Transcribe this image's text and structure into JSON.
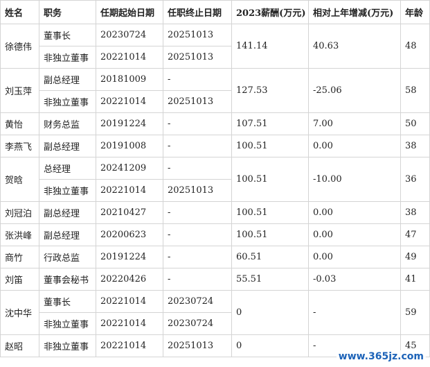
{
  "headers": [
    "姓名",
    "职务",
    "任期起始日期",
    "任职终止日期",
    "2023薪酬(万元)",
    "相对上年增减(万元)",
    "年龄"
  ],
  "people": [
    {
      "name": "徐德伟",
      "roles": [
        {
          "title": "董事长",
          "start": "20230724",
          "end": "20251013"
        },
        {
          "title": "非独立董事",
          "start": "20221014",
          "end": "20251013"
        }
      ],
      "salary": "141.14",
      "change": "40.63",
      "age": "48"
    },
    {
      "name": "刘玉萍",
      "roles": [
        {
          "title": "副总经理",
          "start": "20181009",
          "end": "-"
        },
        {
          "title": "非独立董事",
          "start": "20221014",
          "end": "20251013"
        }
      ],
      "salary": "127.53",
      "change": "-25.06",
      "age": "58"
    },
    {
      "name": "黄怡",
      "roles": [
        {
          "title": "财务总监",
          "start": "20191224",
          "end": "-"
        }
      ],
      "salary": "107.51",
      "change": "7.00",
      "age": "50"
    },
    {
      "name": "李燕飞",
      "roles": [
        {
          "title": "副总经理",
          "start": "20191008",
          "end": "-"
        }
      ],
      "salary": "100.51",
      "change": "0.00",
      "age": "38"
    },
    {
      "name": "贺晗",
      "roles": [
        {
          "title": "总经理",
          "start": "20241209",
          "end": "-"
        },
        {
          "title": "非独立董事",
          "start": "20221014",
          "end": "20251013"
        }
      ],
      "salary": "100.51",
      "change": "-10.00",
      "age": "36"
    },
    {
      "name": "刘冠泊",
      "roles": [
        {
          "title": "副总经理",
          "start": "20210427",
          "end": "-"
        }
      ],
      "salary": "100.51",
      "change": "0.00",
      "age": "38"
    },
    {
      "name": "张洪峰",
      "roles": [
        {
          "title": "副总经理",
          "start": "20200623",
          "end": "-"
        }
      ],
      "salary": "100.51",
      "change": "0.00",
      "age": "47"
    },
    {
      "name": "商竹",
      "roles": [
        {
          "title": "行政总监",
          "start": "20191224",
          "end": "-"
        }
      ],
      "salary": "60.51",
      "change": "0.00",
      "age": "49"
    },
    {
      "name": "刘笛",
      "roles": [
        {
          "title": "董事会秘书",
          "start": "20220426",
          "end": "-"
        }
      ],
      "salary": "55.51",
      "change": "-0.03",
      "age": "41"
    },
    {
      "name": "沈中华",
      "roles": [
        {
          "title": "董事长",
          "start": "20221014",
          "end": "20230724"
        },
        {
          "title": "非独立董事",
          "start": "20221014",
          "end": "20230724"
        }
      ],
      "salary": "0",
      "change": "-",
      "age": "59"
    },
    {
      "name": "赵昭",
      "roles": [
        {
          "title": "非独立董事",
          "start": "20221014",
          "end": "20251013"
        }
      ],
      "salary": "0",
      "change": "-",
      "age": "45"
    }
  ],
  "watermark": "www.365jz.com"
}
